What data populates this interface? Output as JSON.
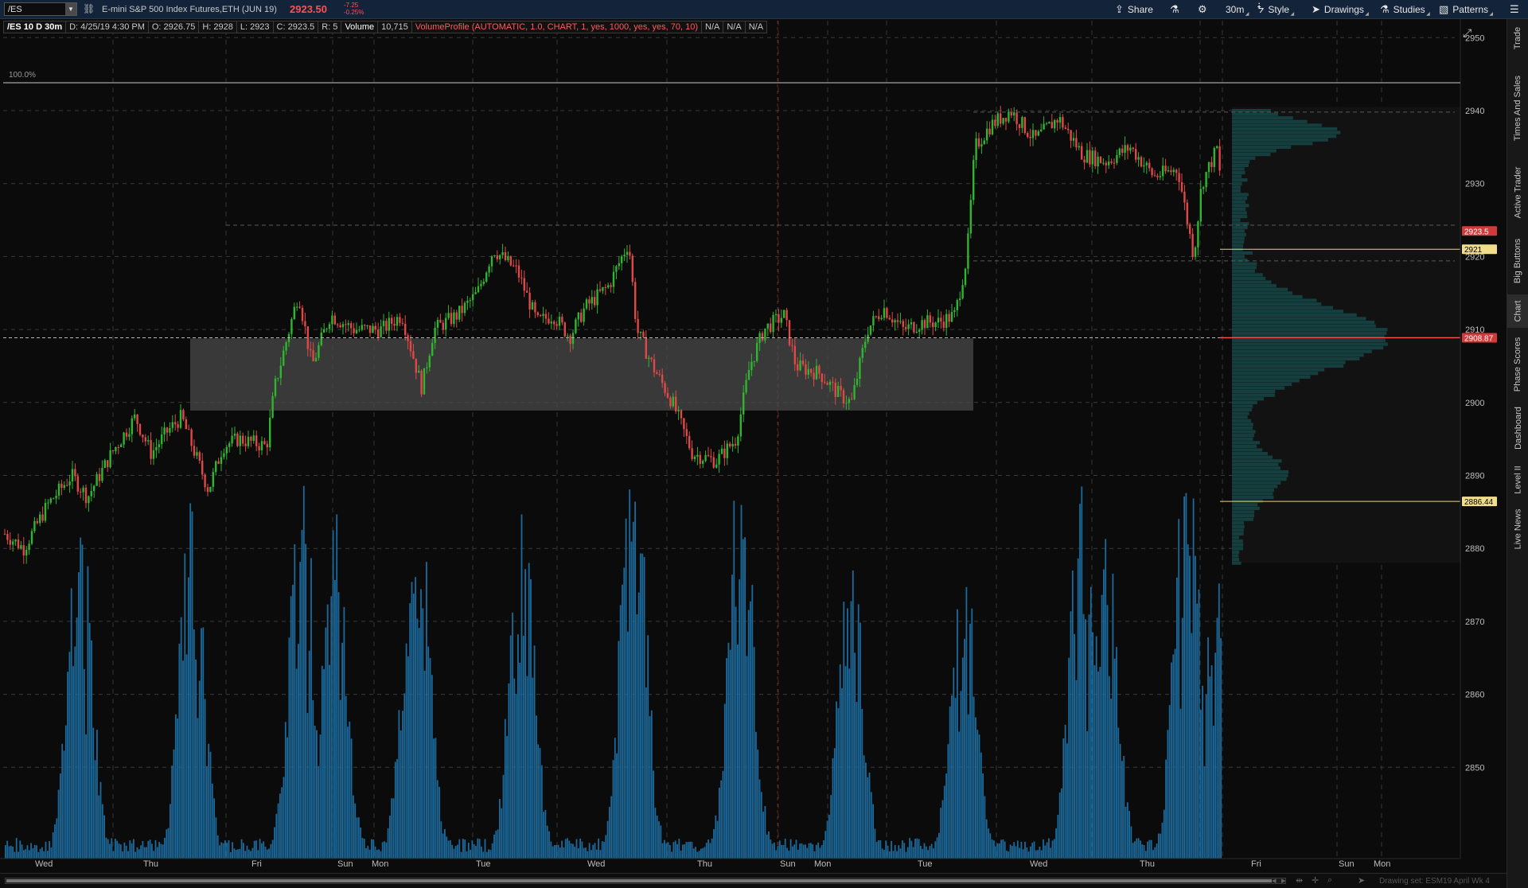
{
  "toolbar": {
    "symbol": "/ES",
    "description": "E-mini S&P 500 Index Futures,ETH (JUN 19)",
    "last_price": "2923.50",
    "net_change": "-7.25",
    "pct_change": "-0.25%",
    "share": "Share",
    "flask_icon": "flask-icon",
    "settings_icon": "gear-icon",
    "timeframe": "30m",
    "style": "Style",
    "drawings": "Drawings",
    "studies": "Studies",
    "patterns": "Patterns",
    "menu_icon": "menu-icon"
  },
  "infobar": {
    "title": "/ES 10 D 30m",
    "date": "D: 4/25/19 4:30 PM",
    "open": "O: 2926.75",
    "high": "H: 2928",
    "low": "L: 2923",
    "close": "C: 2923.5",
    "range": "R: 5",
    "volume_label": "Volume",
    "volume_value": "10,715",
    "study": "VolumeProfile (AUTOMATIC, 1.0, CHART, 1, yes, 1000, yes, yes, 70, 10)",
    "na1": "N/A",
    "na2": "N/A",
    "na3": "N/A"
  },
  "chart": {
    "percent_label": "100.0%",
    "price_levels": [
      "2950",
      "2940",
      "2930",
      "2920",
      "2910",
      "2900",
      "2890",
      "2880",
      "2870",
      "2860",
      "2850"
    ],
    "price_tags": {
      "last": "2923.5",
      "level_a": "2921",
      "level_b": "2908.87",
      "level_c": "2886.44"
    },
    "day_labels": [
      "Wed",
      "Thu",
      "Fri",
      "Sun",
      "Mon",
      "Tue",
      "Wed",
      "Thu",
      "Sun",
      "Mon",
      "Tue",
      "Wed",
      "Thu",
      "Fri",
      "Sun",
      "Mon"
    ],
    "colors": {
      "up": "#2fb52f",
      "down": "#e04848",
      "volume": "#1c6a9c",
      "profile": "#164848",
      "zone": "#4a4a4a",
      "level_line": "#e8d27a"
    }
  },
  "sidebar": {
    "tabs": [
      "Trade",
      "Times And Sales",
      "Active Trader",
      "Big Buttons",
      "Chart",
      "Phase Scores",
      "Dashboard",
      "Level II",
      "Live News"
    ]
  },
  "bottom": {
    "drawing_set": "Drawing set: ESM19 April Wk 4"
  }
}
